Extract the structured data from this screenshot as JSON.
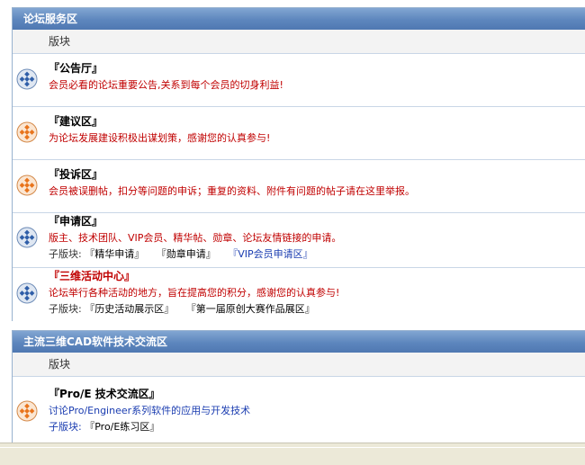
{
  "section1": {
    "title": "论坛服务区",
    "column_label": "版块",
    "forums": [
      {
        "name": "『公告厅』",
        "icon": "forum-blue-icon",
        "desc": "会员必看的论坛重要公告,关系到每个会员的切身利益!",
        "subforums_label": "",
        "subforums": []
      },
      {
        "name": "『建议区』",
        "icon": "forum-orange-icon",
        "desc": "为论坛发展建设积极出谋划策，感谢您的认真参与!",
        "subforums_label": "",
        "subforums": []
      },
      {
        "name": "『投诉区』",
        "icon": "forum-orange-icon",
        "desc": "会员被误删帖，扣分等问题的申诉；重复的资料、附件有问题的帖子请在这里举报。",
        "subforums_label": "",
        "subforums": []
      },
      {
        "name": "『申请区』",
        "icon": "forum-blue-icon",
        "desc": "版主、技术团队、VIP会员、精华帖、勋章、论坛友情链接的申请。",
        "subforums_label": "子版块:",
        "subforums": [
          "『精华申请』",
          "『勋章申请』",
          "『VIP会员申请区』"
        ]
      },
      {
        "name": "『三维活动中心』",
        "icon": "forum-blue-icon",
        "desc": "论坛举行各种活动的地方，旨在提高您的积分，感谢您的认真参与!",
        "subforums_label": "子版块:",
        "subforums": [
          "『历史活动展示区』",
          "『第一届原创大赛作品展区』"
        ]
      }
    ]
  },
  "section2": {
    "title": "主流三维CAD软件技术交流区",
    "column_label": "版块",
    "forums": [
      {
        "name": "『Pro/E 技术交流区』",
        "icon": "forum-orange-icon",
        "desc": "讨论Pro/Engineer系列软件的应用与开发技术",
        "subforums_label": "子版块:",
        "subforums": [
          "『Pro/E练习区』"
        ]
      }
    ]
  },
  "colors": {
    "header_bg": "#5d86bd",
    "icon_blue": "#2f5ea8",
    "icon_orange": "#e8741c",
    "desc_red": "#c00000",
    "desc_blue": "#1a3cb0"
  }
}
